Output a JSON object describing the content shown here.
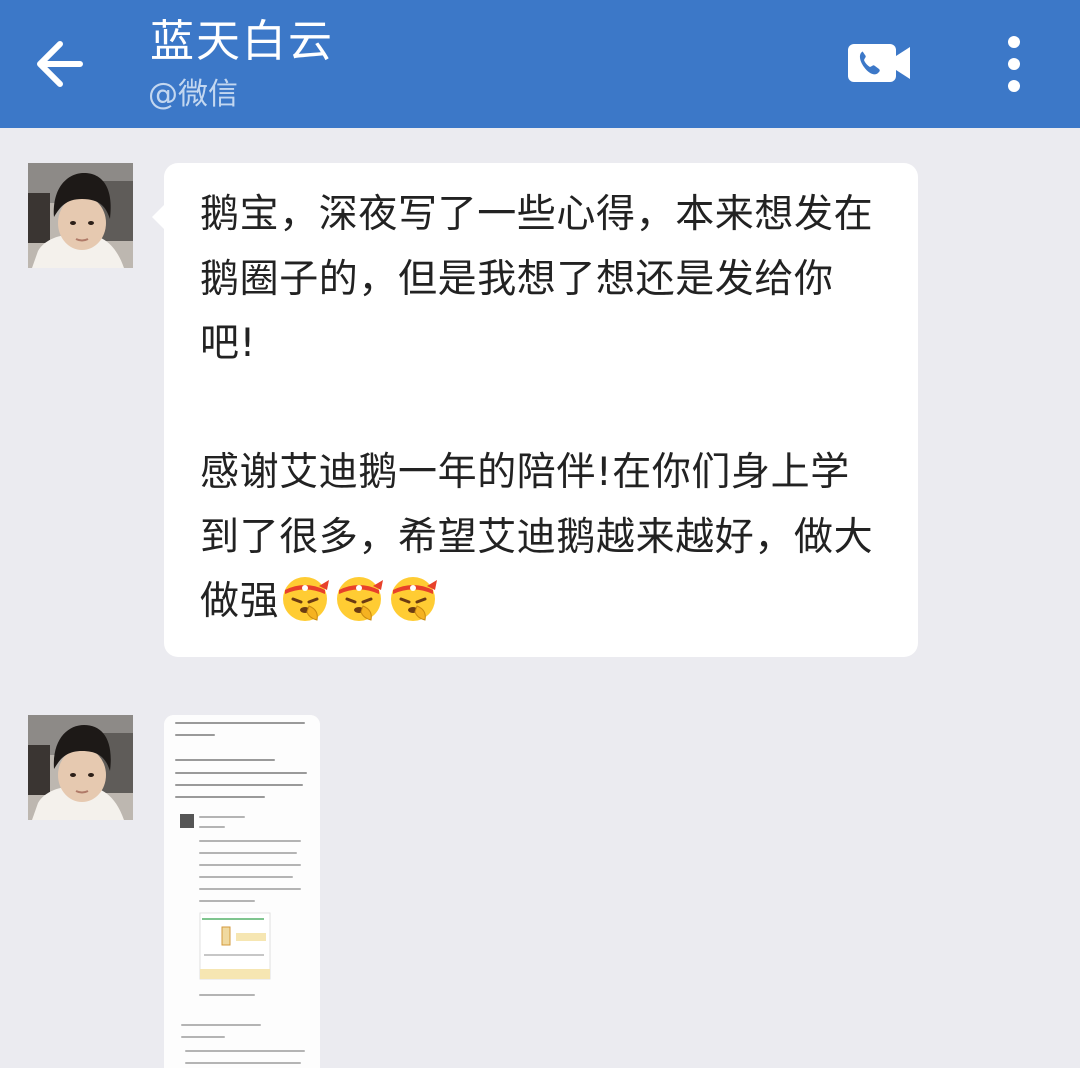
{
  "header": {
    "title": "蓝天白云",
    "subtitle": "@微信"
  },
  "messages": [
    {
      "type": "text",
      "text": "鹅宝，深夜写了一些心得，本来想发在鹅圈子的，但是我想了想还是发给你吧!\n\n感谢艾迪鹅一年的陪伴!在你们身上学到了很多，希望艾迪鹅越来越好，做大做强",
      "emoji": [
        "headband-emoji",
        "headband-emoji",
        "headband-emoji"
      ]
    },
    {
      "type": "image",
      "content": "screenshot-thumbnail"
    }
  ],
  "colors": {
    "header_bg": "#3c78c8",
    "chat_bg": "#ebebf0",
    "bubble_bg": "#ffffff"
  },
  "icons": [
    "back-arrow-icon",
    "video-call-icon",
    "more-vertical-icon"
  ]
}
